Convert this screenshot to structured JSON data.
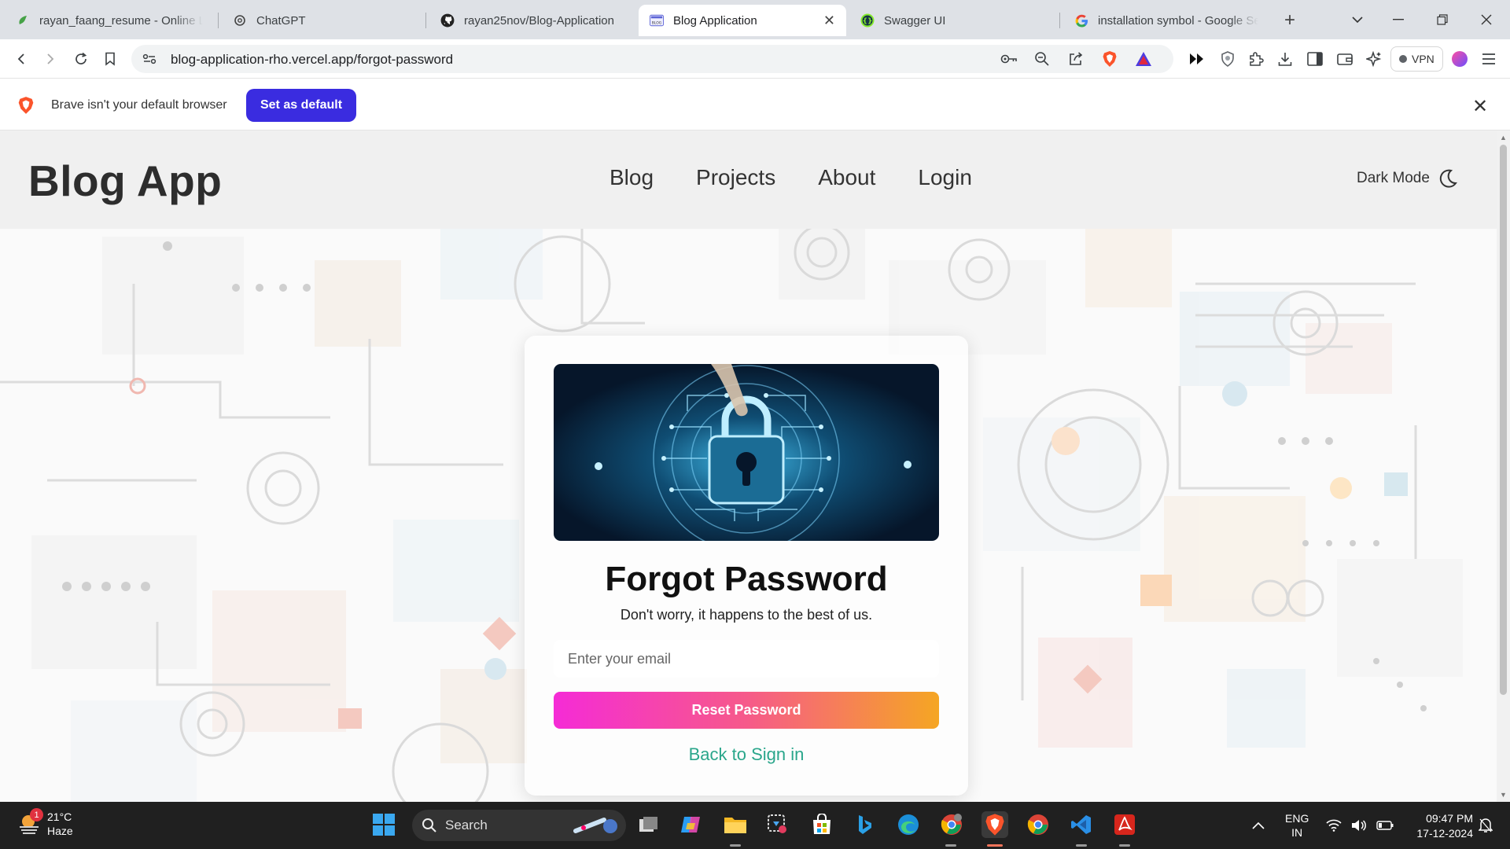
{
  "browser": {
    "tabs": [
      {
        "title": "rayan_faang_resume - Online LaTeX Editor",
        "active": false
      },
      {
        "title": "ChatGPT",
        "active": false
      },
      {
        "title": "rayan25nov/Blog-Application",
        "active": false
      },
      {
        "title": "Blog Application",
        "active": true
      },
      {
        "title": "Swagger UI",
        "active": false
      },
      {
        "title": "installation symbol - Google Search",
        "active": false
      }
    ],
    "url": "blog-application-rho.vercel.app/forgot-password",
    "vpn_label": "VPN",
    "infobar": {
      "message": "Brave isn't your default browser",
      "button": "Set as default"
    }
  },
  "site": {
    "brand": "Blog App",
    "nav": [
      "Blog",
      "Projects",
      "About",
      "Login"
    ],
    "dark_mode_label": "Dark Mode"
  },
  "form": {
    "title": "Forgot Password",
    "subtitle": "Don't worry, it happens to the best of us.",
    "email_placeholder": "Enter your email",
    "email_value": "",
    "submit_label": "Reset Password",
    "back_link": "Back to Sign in"
  },
  "taskbar": {
    "weather_temp": "21°C",
    "weather_desc": "Haze",
    "weather_badge": "1",
    "search_label": "Search",
    "lang_top": "ENG",
    "lang_bottom": "IN",
    "time": "09:47 PM",
    "date": "17-12-2024"
  },
  "colors": {
    "accent_button": "#3a2ce0",
    "gradient_start": "#f52bd6",
    "gradient_end": "#f5a623",
    "link": "#2aa68b"
  }
}
